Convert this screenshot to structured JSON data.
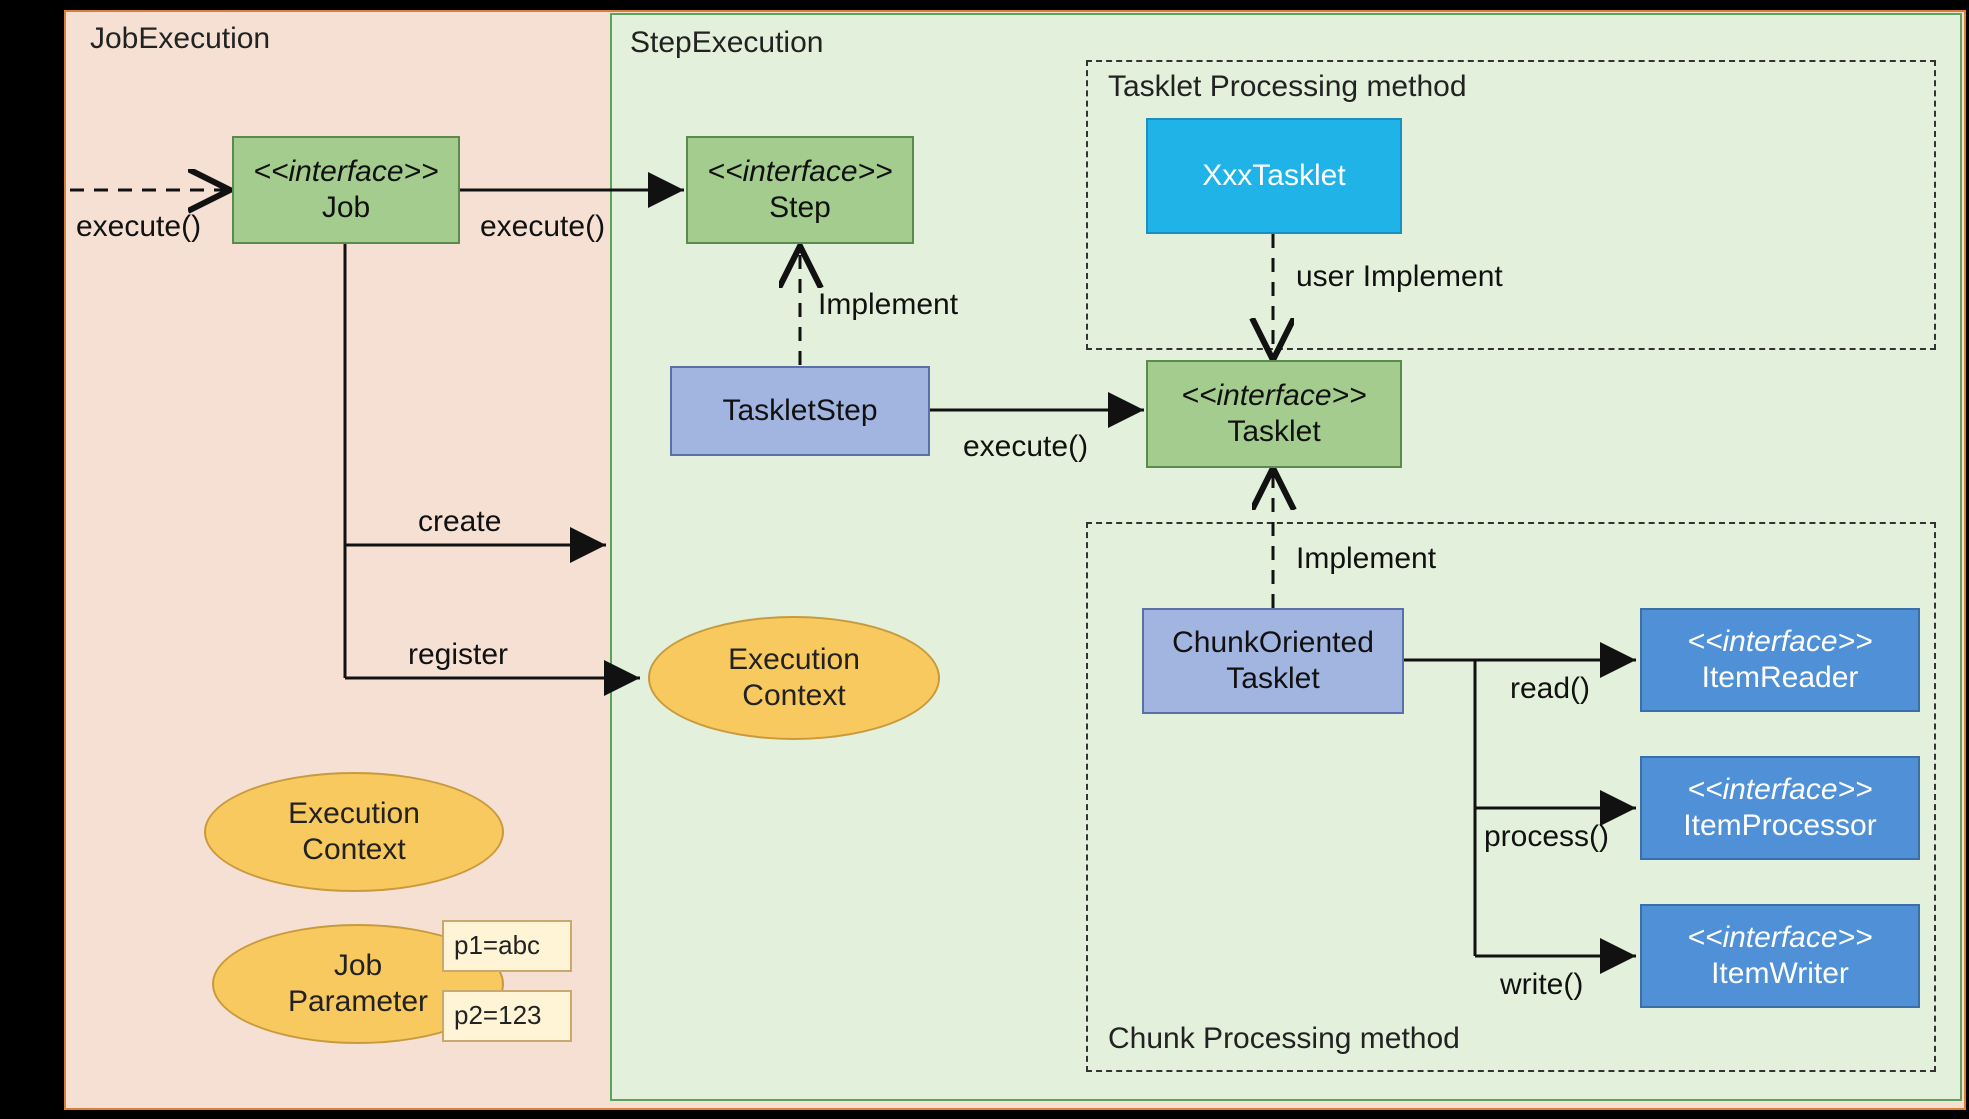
{
  "panels": {
    "job_execution": "JobExecution",
    "step_execution": "StepExecution",
    "tasklet_method": "Tasklet Processing method",
    "chunk_method": "Chunk Processing method"
  },
  "nodes": {
    "job": {
      "stereo": "<<interface>>",
      "name": "Job"
    },
    "step": {
      "stereo": "<<interface>>",
      "name": "Step"
    },
    "tasklet_step": {
      "name": "TaskletStep"
    },
    "tasklet": {
      "stereo": "<<interface>>",
      "name": "Tasklet"
    },
    "xxx_tasklet": {
      "name": "XxxTasklet"
    },
    "chunk_oriented_tasklet": {
      "name": "ChunkOriented\nTasklet"
    },
    "item_reader": {
      "stereo": "<<interface>>",
      "name": "ItemReader"
    },
    "item_processor": {
      "stereo": "<<interface>>",
      "name": "ItemProcessor"
    },
    "item_writer": {
      "stereo": "<<interface>>",
      "name": "ItemWriter"
    },
    "exec_context_step": {
      "l1": "Execution",
      "l2": "Context"
    },
    "exec_context_job": {
      "l1": "Execution",
      "l2": "Context"
    },
    "job_parameter": {
      "l1": "Job",
      "l2": "Parameter"
    },
    "p1": "p1=abc",
    "p2": "p2=123"
  },
  "edges": {
    "execute_job": "execute()",
    "execute_step": "execute()",
    "execute_tasklet": "execute()",
    "implement_step": "Implement",
    "implement_tasklet": "Implement",
    "user_implement": "user Implement",
    "create": "create",
    "register": "register",
    "read": "read()",
    "process": "process()",
    "write": "write()"
  }
}
